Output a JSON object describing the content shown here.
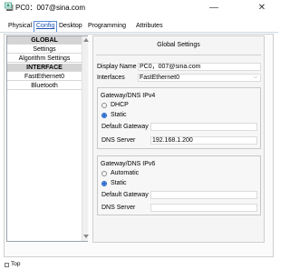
{
  "window": {
    "title": "PC0：007@sina.com",
    "minimize_glyph": "—",
    "close_glyph": "✕",
    "icon": "pc-computer-icon"
  },
  "tabs": [
    {
      "label": "Physical",
      "active": false
    },
    {
      "label": "Config",
      "active": true
    },
    {
      "label": "Desktop",
      "active": false
    },
    {
      "label": "Programming",
      "active": false
    },
    {
      "label": "Attributes",
      "active": false
    }
  ],
  "sidebar": {
    "items": [
      {
        "label": "GLOBAL",
        "header": true
      },
      {
        "label": "Settings",
        "header": false
      },
      {
        "label": "Algorithm Settings",
        "header": false
      },
      {
        "label": "INTERFACE",
        "header": true
      },
      {
        "label": "FastEthernet0",
        "header": false
      },
      {
        "label": "Bluetooth",
        "header": false
      }
    ]
  },
  "global_settings": {
    "title": "Global Settings",
    "display_name_label": "Display Name",
    "display_name_value": "PC0，007@sina.com",
    "interfaces_label": "Interfaces",
    "interfaces_value": "FastEthernet0",
    "ipv4": {
      "title": "Gateway/DNS IPv4",
      "options": [
        {
          "label": "DHCP",
          "selected": false
        },
        {
          "label": "Static",
          "selected": true
        }
      ],
      "default_gateway_label": "Default Gateway",
      "default_gateway_value": "",
      "dns_server_label": "DNS Server",
      "dns_server_value": "192.168.1.200"
    },
    "ipv6": {
      "title": "Gateway/DNS IPv6",
      "options": [
        {
          "label": "Automatic",
          "selected": false
        },
        {
          "label": "Static",
          "selected": true
        }
      ],
      "default_gateway_label": "Default Gateway",
      "default_gateway_value": "",
      "dns_server_label": "DNS Server",
      "dns_server_value": ""
    }
  },
  "status_bar": {
    "top_label": "Top",
    "top_checked": false
  },
  "colors": {
    "accent": "#1e62c9",
    "header_bg": "#d4d4d4"
  }
}
